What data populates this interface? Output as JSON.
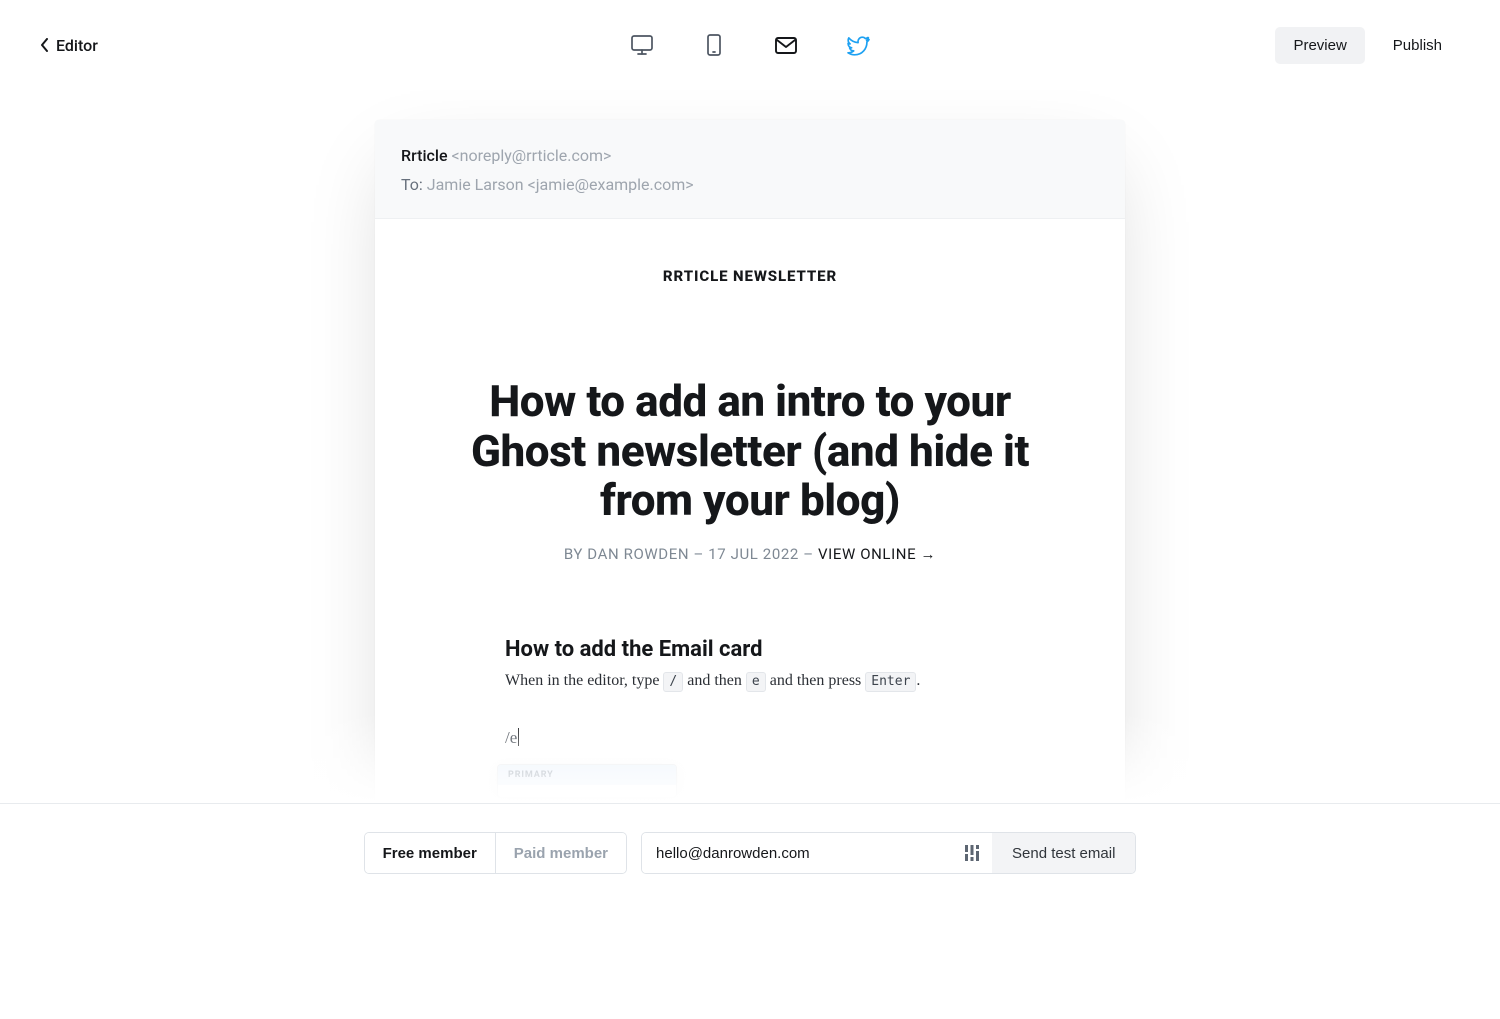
{
  "topbar": {
    "editor_label": "Editor",
    "preview_label": "Preview",
    "publish_label": "Publish"
  },
  "email": {
    "from_name": "Rrticle",
    "from_address": "<noreply@rrticle.com>",
    "to_label": "To:",
    "to_value": "Jamie Larson <jamie@example.com>"
  },
  "newsletter": {
    "title": "RRTICLE NEWSLETTER",
    "post_title": "How to add an intro to your Ghost newsletter (and hide it from your blog)",
    "byline_prefix": "BY DAN ROWDEN – 17 JUL 2022 – ",
    "view_online": "VIEW ONLINE",
    "view_online_arrow": "→"
  },
  "content": {
    "heading": "How to add the Email card",
    "para_segments": {
      "a": "When in the editor, type ",
      "k1": "/",
      "b": " and then ",
      "k2": "e",
      "c": " and then press ",
      "k3": "Enter",
      "d": "."
    },
    "slash_e": "/e",
    "dropdown_label": "PRIMARY"
  },
  "bottombar": {
    "free_label": "Free member",
    "paid_label": "Paid member",
    "email_value": "hello@danrowden.com",
    "send_label": "Send test email"
  }
}
